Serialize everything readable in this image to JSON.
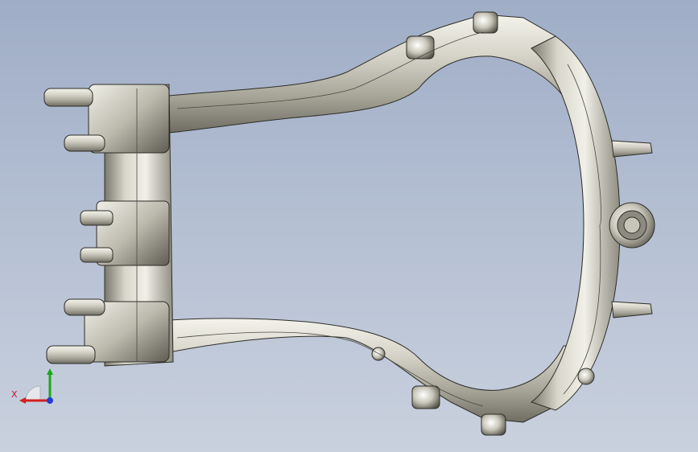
{
  "viewport": {
    "background_top": "#9fadc6",
    "background_bottom": "#c9d1de"
  },
  "model": {
    "icon": "subframe-3d-model",
    "metal_light": "#e9e8df",
    "metal_mid": "#b9b7aa",
    "metal_dark": "#6f6d62",
    "edge_color": "#2d2c27"
  },
  "triad": {
    "x_label": "X",
    "x_color": "#d21f1f",
    "y_color": "#1aa81a",
    "z_color": "#1f3fd2"
  }
}
